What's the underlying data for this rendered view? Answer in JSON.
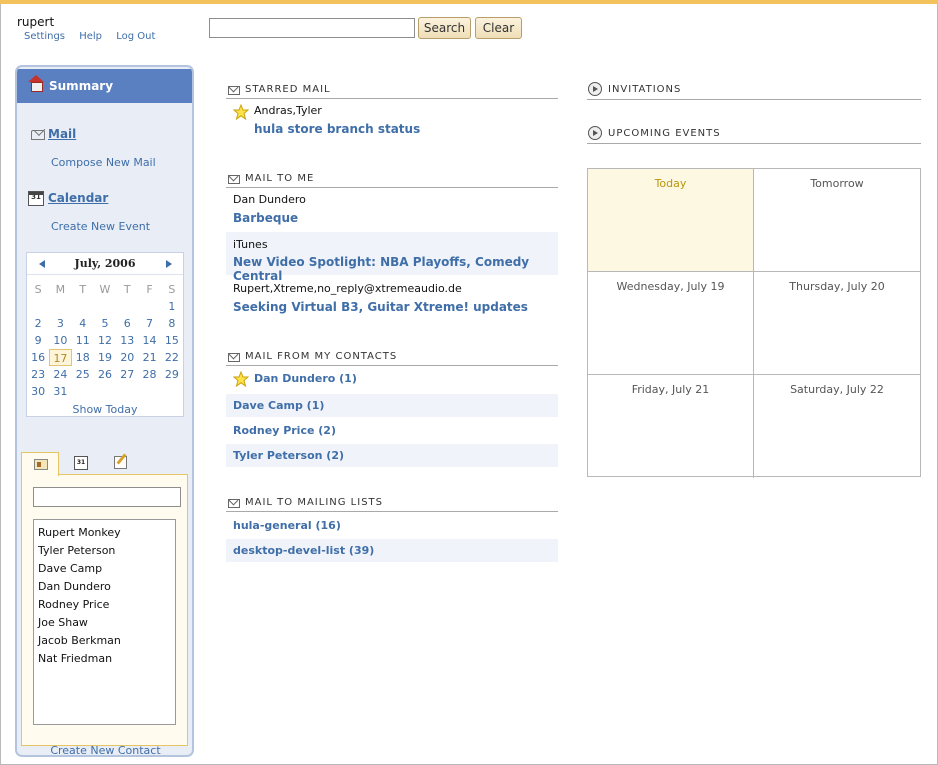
{
  "header": {
    "username": "rupert",
    "links": [
      "Settings",
      "Help",
      "Log Out"
    ],
    "search_value": "",
    "search_button": "Search",
    "clear_button": "Clear"
  },
  "sidebar": {
    "summary_label": "Summary",
    "mail_label": "Mail",
    "compose_label": "Compose New Mail",
    "calendar_label": "Calendar",
    "create_event_label": "Create New Event",
    "calendar_icon_text": "31"
  },
  "minical": {
    "month_label": "July, 2006",
    "weekdays": [
      "S",
      "M",
      "T",
      "W",
      "T",
      "F",
      "S"
    ],
    "weeks": [
      [
        "",
        "",
        "",
        "",
        "",
        "",
        "1"
      ],
      [
        "2",
        "3",
        "4",
        "5",
        "6",
        "7",
        "8"
      ],
      [
        "9",
        "10",
        "11",
        "12",
        "13",
        "14",
        "15"
      ],
      [
        "16",
        "17",
        "18",
        "19",
        "20",
        "21",
        "22"
      ],
      [
        "23",
        "24",
        "25",
        "26",
        "27",
        "28",
        "29"
      ],
      [
        "30",
        "31",
        "",
        "",
        "",
        "",
        ""
      ]
    ],
    "today": "17",
    "show_today_label": "Show Today"
  },
  "contacts": {
    "tabs": [
      "contacts-tab",
      "calendar-tab",
      "notes-tab"
    ],
    "calendar_tab_text": "31",
    "search_value": "",
    "list": [
      "Rupert Monkey",
      "Tyler Peterson",
      "Dave Camp",
      "Dan Dundero",
      "Rodney Price",
      "Joe Shaw",
      "Jacob Berkman",
      "Nat Friedman"
    ],
    "create_label": "Create New Contact"
  },
  "starred_mail": {
    "title": "Starred Mail",
    "items": [
      {
        "sender": "Andras,Tyler",
        "subject": "hula store branch status",
        "starred": true
      }
    ]
  },
  "mail_to_me": {
    "title": "Mail to me",
    "items": [
      {
        "sender": "Dan Dundero",
        "subject": "Barbeque"
      },
      {
        "sender": "iTunes",
        "subject": "New Video Spotlight: NBA Playoffs, Comedy Central"
      },
      {
        "sender": "Rupert,Xtreme,no_reply@xtremeaudio.de",
        "subject": "Seeking Virtual B3, Guitar Xtreme! updates"
      }
    ]
  },
  "mail_from_contacts": {
    "title": "Mail from my contacts",
    "items": [
      {
        "label": "Dan Dundero (1)",
        "starred": true
      },
      {
        "label": "Dave Camp (1)",
        "starred": false
      },
      {
        "label": "Rodney Price (2)",
        "starred": false
      },
      {
        "label": "Tyler Peterson (2)",
        "starred": false
      }
    ]
  },
  "mailing_lists": {
    "title": "Mail to mailing lists",
    "items": [
      "hula-general (16)",
      "desktop-devel-list (39)"
    ]
  },
  "invitations": {
    "title": "Invitations"
  },
  "upcoming": {
    "title": "Upcoming Events",
    "days": [
      "Today",
      "Tomorrow",
      "Wednesday, July 19",
      "Thursday, July 20",
      "Friday, July 21",
      "Saturday, July 22"
    ]
  },
  "colors": {
    "accent": "#3f6ea8",
    "summary_bg": "#5a80c2",
    "top_bar": "#f3c25c",
    "today_bg": "#fdf8e2"
  }
}
